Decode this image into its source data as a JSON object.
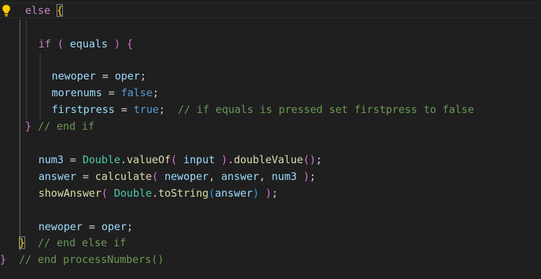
{
  "editor": {
    "line1": {
      "kw": "else",
      "brace": "{"
    },
    "line2": {
      "kw": "if",
      "paren_open": "(",
      "var": "equals",
      "paren_close": ")",
      "brace": "{"
    },
    "line3": {
      "var1": "newoper",
      "op": "=",
      "var2": "oper",
      "semi": ";"
    },
    "line4": {
      "var": "morenums",
      "op": "=",
      "val": "false",
      "semi": ";"
    },
    "line5": {
      "var": "firstpress",
      "op": "=",
      "val": "true",
      "semi": ";",
      "comment": "// if equals is pressed set firstpress to false"
    },
    "line6": {
      "brace": "}",
      "comment": "// end if"
    },
    "line7": {
      "var": "num3",
      "op": "=",
      "cls": "Double",
      "dot1": ".",
      "fn1": "valueOf",
      "paren1": "(",
      "arg": "input",
      "paren2": ")",
      "dot2": ".",
      "fn2": "doubleValue",
      "paren3": "()",
      "semi": ";"
    },
    "line8": {
      "var": "answer",
      "op": "=",
      "fn": "calculate",
      "paren1": "(",
      "arg1": "newoper",
      "comma1": ",",
      "arg2": "answer",
      "comma2": ",",
      "arg3": "num3",
      "paren2": ")",
      "semi": ";"
    },
    "line9": {
      "fn": "showAnswer",
      "paren1": "(",
      "cls": "Double",
      "dot": ".",
      "fn2": "toString",
      "paren2": "(",
      "arg": "answer",
      "paren3": ")",
      "paren4": ")",
      "semi": ";"
    },
    "line10": {
      "var1": "newoper",
      "op": "=",
      "var2": "oper",
      "semi": ";"
    },
    "line11": {
      "brace": "}",
      "comment": "// end else if"
    },
    "line12": {
      "brace": "}",
      "comment": "// end processNumbers()"
    }
  },
  "colors": {
    "background": "#1f1f1f",
    "keyword": "#c586c0",
    "variable": "#9cdcfe",
    "function": "#dcdcaa",
    "class": "#4ec9b0",
    "boolean": "#569cd6",
    "comment": "#6a9955",
    "bracket_level1": "#ffd700",
    "bracket_level2": "#da70d6",
    "bracket_level3": "#179fff"
  },
  "icons": {
    "gutter": "lightbulb-icon"
  }
}
